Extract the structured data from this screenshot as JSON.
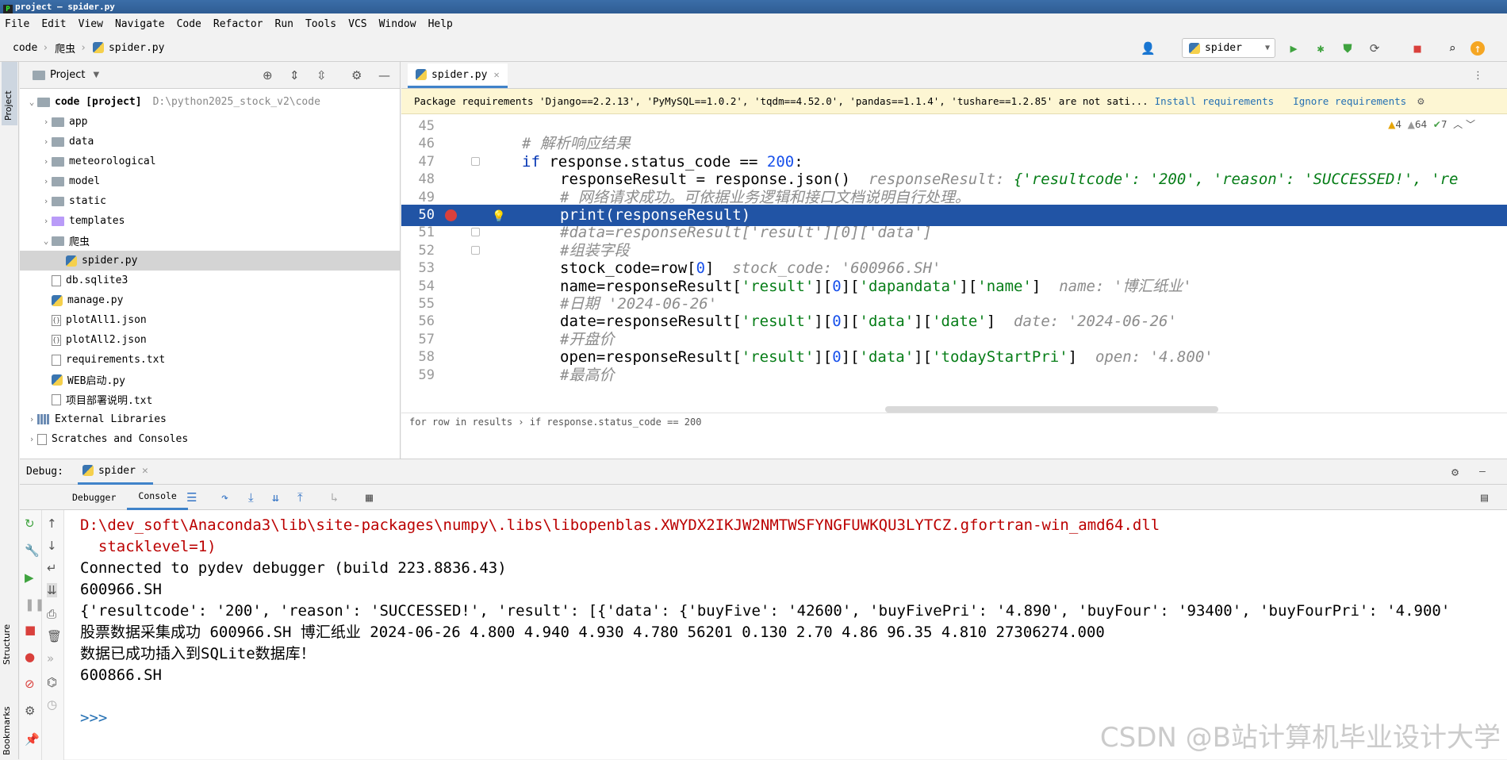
{
  "window": {
    "title": "project – spider.py"
  },
  "menu": [
    "File",
    "Edit",
    "View",
    "Navigate",
    "Code",
    "Refactor",
    "Run",
    "Tools",
    "VCS",
    "Window",
    "Help"
  ],
  "breadcrumb": [
    "code",
    "爬虫",
    "spider.py"
  ],
  "run_config": "spider",
  "left_strip": {
    "project": "Project",
    "structure": "Structure",
    "bookmarks": "Bookmarks"
  },
  "project_panel": {
    "title": "Project",
    "tree": [
      {
        "label": "code [project]",
        "path": "D:\\python2025_stock_v2\\code",
        "kind": "folder",
        "depth": 0,
        "expanded": true
      },
      {
        "label": "app",
        "kind": "folder",
        "depth": 1
      },
      {
        "label": "data",
        "kind": "folder",
        "depth": 1
      },
      {
        "label": "meteorological",
        "kind": "folder",
        "depth": 1
      },
      {
        "label": "model",
        "kind": "folder",
        "depth": 1
      },
      {
        "label": "static",
        "kind": "folder",
        "depth": 1
      },
      {
        "label": "templates",
        "kind": "folder-purple",
        "depth": 1
      },
      {
        "label": "爬虫",
        "kind": "folder",
        "depth": 1,
        "expanded": true
      },
      {
        "label": "spider.py",
        "kind": "py",
        "depth": 2,
        "selected": true
      },
      {
        "label": "db.sqlite3",
        "kind": "file",
        "depth": 1
      },
      {
        "label": "manage.py",
        "kind": "py",
        "depth": 1
      },
      {
        "label": "plotAll1.json",
        "kind": "json",
        "depth": 1
      },
      {
        "label": "plotAll2.json",
        "kind": "json",
        "depth": 1
      },
      {
        "label": "requirements.txt",
        "kind": "file",
        "depth": 1
      },
      {
        "label": "WEB启动.py",
        "kind": "py",
        "depth": 1
      },
      {
        "label": "项目部署说明.txt",
        "kind": "file",
        "depth": 1
      },
      {
        "label": "External Libraries",
        "kind": "lib",
        "depth": 0
      },
      {
        "label": "Scratches and Consoles",
        "kind": "scratch",
        "depth": 0
      }
    ]
  },
  "editor": {
    "tab": "spider.py",
    "banner": {
      "text": "Package requirements 'Django==2.2.13', 'PyMySQL==1.0.2', 'tqdm==4.52.0', 'pandas==1.1.4', 'tushare==1.2.85' are not sati...",
      "install": "Install requirements",
      "ignore": "Ignore requirements"
    },
    "inspections": {
      "warnings": "4",
      "weak": "64",
      "ok": "7"
    },
    "lines": [
      {
        "n": "45",
        "indent": 1,
        "html": ""
      },
      {
        "n": "46",
        "indent": 1,
        "html": "<span class=\"cmt\"># 解析响应结果</span>"
      },
      {
        "n": "47",
        "indent": 1,
        "html": "<span class=\"kw\">if</span> response.status_code == <span class=\"num\">200</span>:"
      },
      {
        "n": "48",
        "indent": 2,
        "html": "responseResult = response.json()  <span class=\"hint\">responseResult: <span class=\"str\">{'resultcode': '200', 'reason': 'SUCCESSED!', 're</span></span>"
      },
      {
        "n": "49",
        "indent": 2,
        "html": "<span class=\"cmt\"># 网络请求成功。可依据业务逻辑和接口文档说明自行处理。</span>"
      },
      {
        "n": "50",
        "indent": 2,
        "html": "print(responseResult)",
        "hl": true
      },
      {
        "n": "51",
        "indent": 2,
        "html": "<span class=\"cmt\">#data=responseResult['result'][0]['data']</span>"
      },
      {
        "n": "52",
        "indent": 2,
        "html": "<span class=\"cmt\">#组装字段</span>"
      },
      {
        "n": "53",
        "indent": 2,
        "html": "stock_code=row[<span class=\"num\">0</span>]  <span class=\"hint\">stock_code: '600966.SH'</span>"
      },
      {
        "n": "54",
        "indent": 2,
        "html": "name=responseResult[<span class=\"str\">'result'</span>][<span class=\"num\">0</span>][<span class=\"str\">'dapandata'</span>][<span class=\"str\">'name'</span>]  <span class=\"hint\">name: '博汇纸业'</span>"
      },
      {
        "n": "55",
        "indent": 2,
        "html": "<span class=\"cmt\">#日期 '2024-06-26'</span>"
      },
      {
        "n": "56",
        "indent": 2,
        "html": "date=responseResult[<span class=\"str\">'result'</span>][<span class=\"num\">0</span>][<span class=\"str\">'data'</span>][<span class=\"str\">'date'</span>]  <span class=\"hint\">date: '2024-06-26'</span>"
      },
      {
        "n": "57",
        "indent": 2,
        "html": "<span class=\"cmt\">#开盘价</span>"
      },
      {
        "n": "58",
        "indent": 2,
        "html": "open=responseResult[<span class=\"str\">'result'</span>][<span class=\"num\">0</span>][<span class=\"str\">'data'</span>][<span class=\"str\">'todayStartPri'</span>]  <span class=\"hint\">open: '4.800'</span>"
      },
      {
        "n": "59",
        "indent": 2,
        "html": "<span class=\"cmt\">#最高价</span>"
      }
    ],
    "breadcrumbs": "for row in results  ›  if response.status_code == 200"
  },
  "debug": {
    "label": "Debug:",
    "tab": "spider",
    "subtabs": [
      "Debugger",
      "Console"
    ],
    "output": [
      {
        "cls": "err",
        "text": "D:\\dev_soft\\Anaconda3\\lib\\site-packages\\numpy\\.libs\\libopenblas.XWYDX2IKJW2NMTWSFYNGFUWKQU3LYTCZ.gfortran-win_amd64.dll"
      },
      {
        "cls": "err",
        "text": "  stacklevel=1)"
      },
      {
        "cls": "",
        "text": "Connected to pydev debugger (build 223.8836.43)"
      },
      {
        "cls": "",
        "text": "600966.SH"
      },
      {
        "cls": "",
        "text": "{'resultcode': '200', 'reason': 'SUCCESSED!', 'result': [{'data': {'buyFive': '42600', 'buyFivePri': '4.890', 'buyFour': '93400', 'buyFourPri': '4.900'"
      },
      {
        "cls": "",
        "text": "股票数据采集成功 600966.SH 博汇纸业 2024-06-26 4.800 4.940 4.930 4.780 56201 0.130 2.70 4.86 96.35 4.810 27306274.000"
      },
      {
        "cls": "",
        "text": "数据已成功插入到SQLite数据库！"
      },
      {
        "cls": "",
        "text": "600866.SH"
      },
      {
        "cls": "",
        "text": ""
      },
      {
        "cls": "",
        "text": ">>>"
      }
    ]
  },
  "watermark": "CSDN @B站计算机毕业设计大学"
}
